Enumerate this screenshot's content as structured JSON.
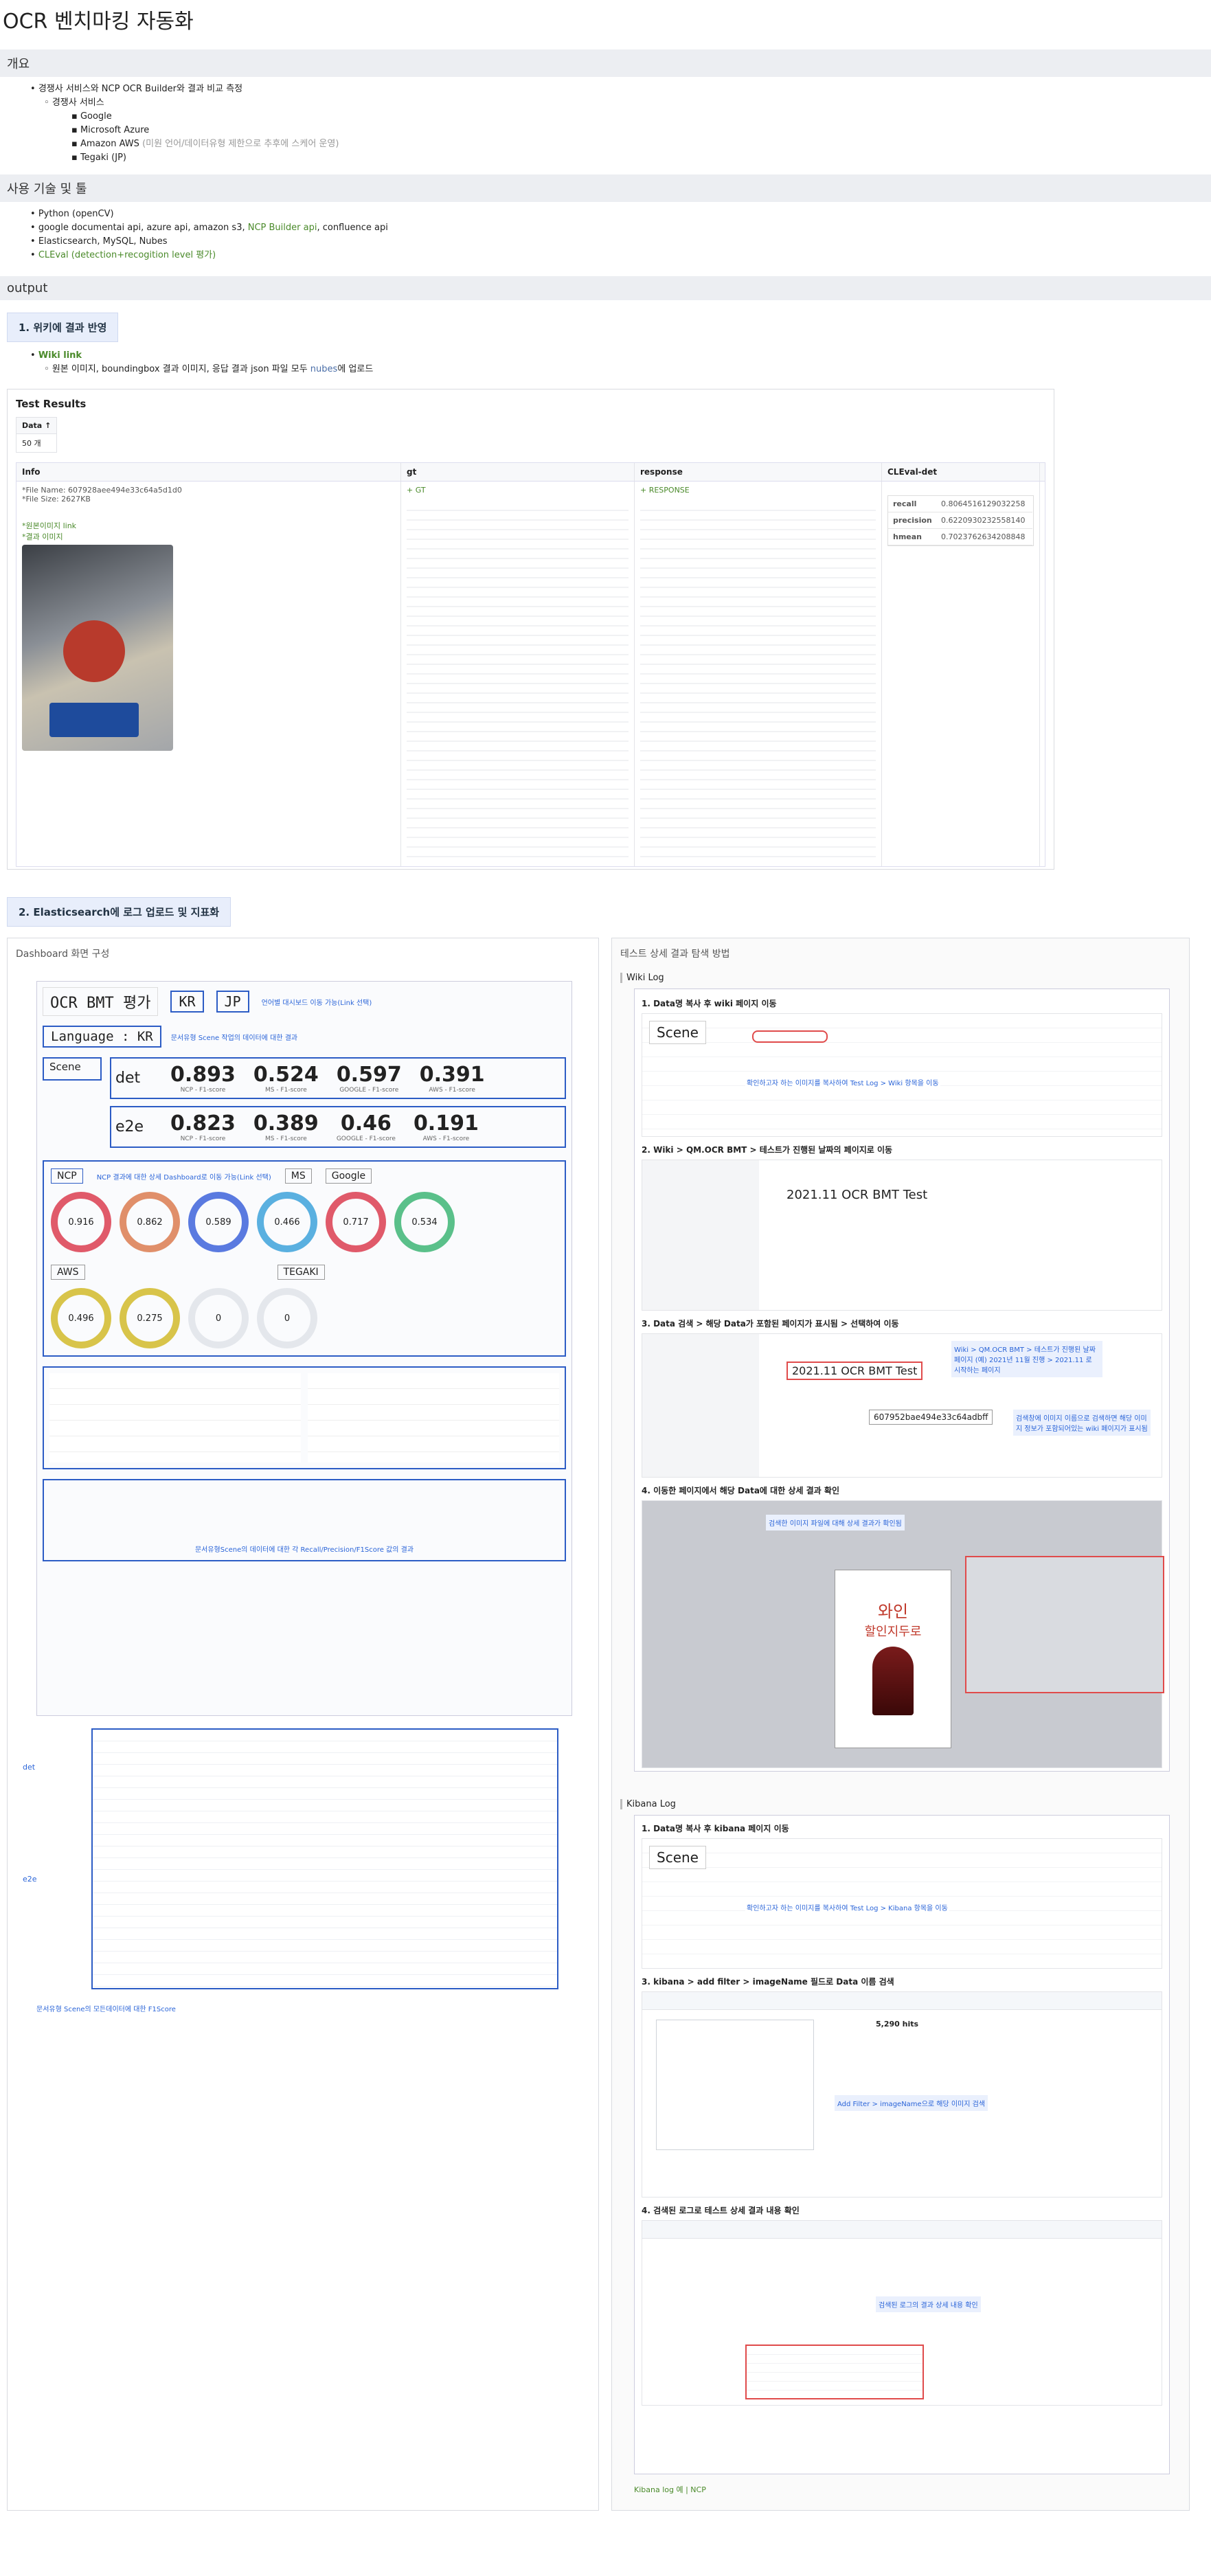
{
  "title": "OCR 벤치마킹 자동화",
  "overview": {
    "heading": "개요",
    "item": "경쟁사 서비스와 NCP OCR Builder와 결과 비교 측정",
    "sub": "경쟁사 서비스",
    "vendors": [
      "Google",
      "Microsoft Azure",
      "Amazon AWS",
      "Tegaki (JP)"
    ],
    "aws_note": "(미원 언어/데이터유형 제한으로 추후에 스케어 운영)"
  },
  "tech": {
    "heading": "사용 기술 및 툴",
    "items": [
      "Python (openCV)",
      "google documentai api, azure api, amazon s3, ",
      "Elasticsearch, MySQL, Nubes",
      "CLEval (detection+recogition level 평가)"
    ],
    "ncp_link": "NCP Builder api",
    "confluence": ", confluence api"
  },
  "output": {
    "heading": "output"
  },
  "section1": {
    "title": "1. 위키에 결과 반영",
    "wiki_link": "Wiki link",
    "desc": "원본 이미지, boundingbox 결과 이미지, 응답 결과 json 파일 모두 ",
    "nubes": "nubes",
    "desc2": "에 업로드"
  },
  "test_results": {
    "title": "Test Results",
    "data_label": "Data ↑",
    "data_value": "50 개",
    "cols": [
      "Info",
      "gt",
      "response",
      "CLEval-det"
    ],
    "file_name": "*File Name: 6079​28aee494e33c64a5d1d0",
    "file_size": "*File Size: 2627KB",
    "orig_link": "*원본이미지 link",
    "bbox_link": "*결과 이미지",
    "gt_label": "+ GT",
    "resp_label": "+ RESPONSE",
    "metrics": [
      {
        "k": "recall",
        "v": "0.8064516129032258"
      },
      {
        "k": "precision",
        "v": "0.6220930232558140"
      },
      {
        "k": "hmean",
        "v": "0.7023762634208848"
      }
    ]
  },
  "section2": {
    "title": "2. Elasticsearch에 로그 업로드 및 지표화",
    "left_caption": "Dashboard 화면 구성",
    "right_caption": "테스트 상세 결과 탐색 방법"
  },
  "dashboard": {
    "app": "OCR BMT 평가",
    "lang": "Language : KR",
    "kr": "KR",
    "jp": "JP",
    "scene": "Scene",
    "det": "det",
    "e2e": "e2e",
    "det_vals": [
      "0.893",
      "0.524",
      "0.597",
      "0.391"
    ],
    "e2e_vals": [
      "0.823",
      "0.389",
      "0.46",
      "0.191"
    ],
    "kpi_labels": [
      "NCP - F1-score",
      "MS - F1-score",
      "GOOGLE - F1-score",
      "AWS - F1-score"
    ],
    "ncp": "NCP",
    "ms": "MS",
    "google": "Google",
    "aws": "AWS",
    "tegaki": "TEGAKI",
    "gauges": [
      "0.916",
      "0.862",
      "0.589",
      "0.466",
      "0.717",
      "0.534"
    ],
    "gauges2": [
      "0.496",
      "0.275",
      "0",
      "0"
    ],
    "note1": "언어별 대시보드 이동 가능(Link 선택)",
    "note2": "문서유형 Scene 작업의 데이터에 대한 결과",
    "note3": "NCP 결과에 대한 상세 Dashboard로 이동 가능(Link 선택)",
    "note4": "문서유형 Scene의 모든데이터에 대한 F1Score",
    "note5": "문서유형Scene의 데이터에 대한 각 Recall/Precision/F1Score 값의 결과",
    "det_note": "det",
    "e2e_note": "e2e"
  },
  "wiki_log": {
    "title": "Wiki Log",
    "s1": "1. Data명 복사 후 wiki 페이지 이동",
    "s2": "2. Wiki > QM.OCR BMT > 테스트가 진행된 날짜의 페이지로 이동",
    "s3": "3. Data 검색 > 해당 Data가 포함된 페이지가 표시됨 > 선택하여 이동",
    "s4": "4. 이동한 페이지에서 해당 Data에 대한 상세 결과 확인",
    "page_title": "2021.11 OCR BMT Test",
    "data_id": "6079​52bae494e33c64adbff",
    "note_a": "확인하고자 하는 이미지를 복사하여 Test Log > Wiki 항목을 이동",
    "note_b": "Wiki > QM.OCR BMT > 테스트가 진행된 날짜페이지 (예) 2021년 11월 진행 > 2021.11 로 시작하는 페이지",
    "note_c": "검색창에 이미지 이름으로 검색하면 해당 이미지 정보가 포함되어있는 wiki 페이지가 표시됨",
    "note_d": "검색한 이미지 파일에 대해 상세 결과가 확인됨",
    "poster1": "와인",
    "poster2": "할인지두로"
  },
  "kibana_log": {
    "title": "Kibana Log",
    "s1": "1. Data명 복사 후 kibana 페이지 이동",
    "s3": "3. kibana > add filter > imageName 필드로 Data 이름 검색",
    "s4": "4. 검색된 로그로 테스트 상세 결과 내용 확인",
    "note_a": "확인하고자 하는 이미지를 복사하여 Test Log > Kibana 항목을 이동",
    "note_b": "Add Filter > imageName으로 해당 이미지 검색",
    "note_c": "검색된 로그의 결과 상세 내용 확인",
    "footer": "Kibana log 예 | NCP",
    "hits": "5,290 hits"
  }
}
